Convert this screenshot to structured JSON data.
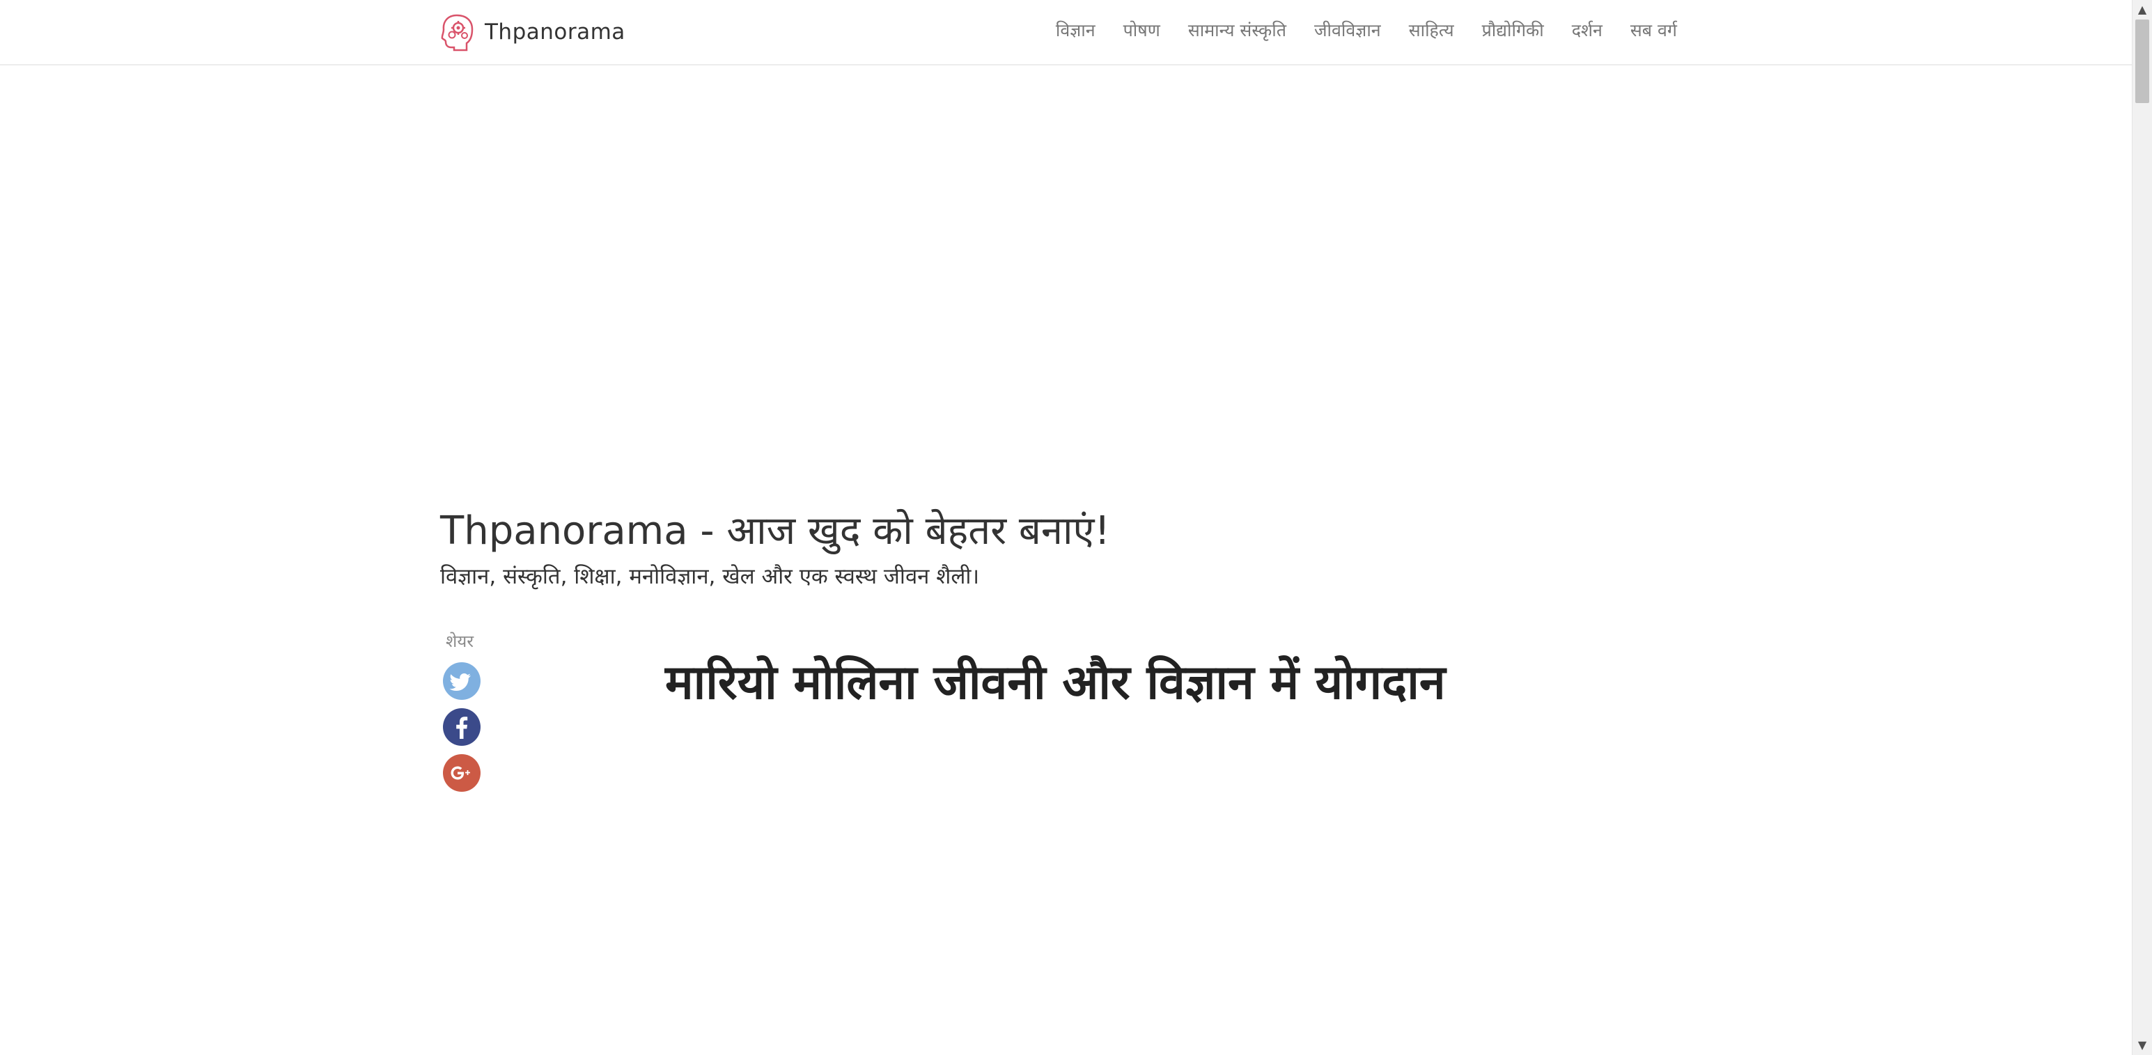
{
  "header": {
    "brand_name": "Thpanorama",
    "logo_icon": "brain-gears-icon",
    "nav": [
      "विज्ञान",
      "पोषण",
      "सामान्य संस्कृति",
      "जीवविज्ञान",
      "साहित्य",
      "प्रौद्योगिकी",
      "दर्शन",
      "सब वर्ग"
    ]
  },
  "hero": {
    "title": "Thpanorama - आज खुद को बेहतर बनाएं!",
    "subtitle": "विज्ञान, संस्कृति, शिक्षा, मनोविज्ञान, खेल और एक स्वस्थ जीवन शैली।"
  },
  "share": {
    "label": "शेयर",
    "buttons": [
      {
        "icon": "twitter-icon",
        "color": "#7fb0e0"
      },
      {
        "icon": "facebook-icon",
        "color": "#3b4a8a"
      },
      {
        "icon": "google-plus-icon",
        "color": "#cc5a45"
      }
    ]
  },
  "article": {
    "title": "मारियो मोलिना जीवनी और विज्ञान में योगदान"
  },
  "colors": {
    "brand_logo": "#d9536a",
    "nav_text": "#777777",
    "title_text": "#222222"
  }
}
